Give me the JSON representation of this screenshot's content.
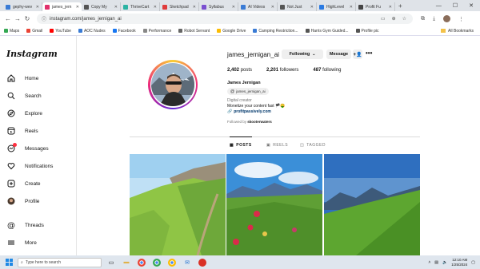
{
  "browser": {
    "tabs": [
      {
        "label": "gephy-wev",
        "color": "#3a7bd5"
      },
      {
        "label": "james_jern",
        "color": "#e1306c",
        "active": true
      },
      {
        "label": "Copy My",
        "color": "#555"
      },
      {
        "label": "ThriveCart",
        "color": "#2bb3a3"
      },
      {
        "label": "Sketchpad",
        "color": "#e03b3b"
      },
      {
        "label": "Syllabus",
        "color": "#7a4fd0"
      },
      {
        "label": "AI Videos",
        "color": "#3a7bd5"
      },
      {
        "label": "Not Just",
        "color": "#555"
      },
      {
        "label": "HighLevel",
        "color": "#2a7ae2"
      },
      {
        "label": "Profit Fu",
        "color": "#444"
      }
    ],
    "url": "instagram.com/james_jernigan_ai",
    "bookmarks": [
      {
        "label": "Maps",
        "color": "#34a853"
      },
      {
        "label": "Gmail",
        "color": "#ea4335"
      },
      {
        "label": "YouTube",
        "color": "#ff0000"
      },
      {
        "label": "AOC Nudes",
        "color": "#3a7bd5"
      },
      {
        "label": "Facebook",
        "color": "#1877f2"
      },
      {
        "label": "Performance",
        "color": "#888"
      },
      {
        "label": "Robot Servant",
        "color": "#666"
      },
      {
        "label": "Google Drive",
        "color": "#fbbc04"
      },
      {
        "label": "Camping Restriction...",
        "color": "#3a7bd5"
      },
      {
        "label": "Harris Gym Guided...",
        "color": "#555"
      },
      {
        "label": "Profile pic",
        "color": "#555"
      }
    ],
    "all_bookmarks": "All Bookmarks"
  },
  "sidebar": {
    "logo": "Instagram",
    "items": [
      {
        "label": "Home",
        "icon": "home-icon"
      },
      {
        "label": "Search",
        "icon": "search-icon"
      },
      {
        "label": "Explore",
        "icon": "compass-icon"
      },
      {
        "label": "Reels",
        "icon": "reels-icon"
      },
      {
        "label": "Messages",
        "icon": "messenger-icon",
        "badge": "1"
      },
      {
        "label": "Notifications",
        "icon": "heart-icon"
      },
      {
        "label": "Create",
        "icon": "plus-square-icon"
      },
      {
        "label": "Profile",
        "icon": "profile-icon"
      },
      {
        "label": "Threads",
        "icon": "threads-icon"
      },
      {
        "label": "More",
        "icon": "menu-icon"
      }
    ]
  },
  "profile": {
    "username": "james_jernigan_ai",
    "following_btn": "Following",
    "message_btn": "Message",
    "stats": {
      "posts": "2,402",
      "posts_label": "posts",
      "followers": "2,201",
      "followers_label": "followers",
      "following": "487",
      "following_label": "following"
    },
    "full_name": "James Jernigan",
    "threads_handle": "james_jernigan_ai",
    "category": "Digital creator",
    "bio": "Monetize your content fast 🏴🤑",
    "link": "profitpassively.com",
    "followed_by": "Followed by ",
    "followed_by_user": "skooterwaters"
  },
  "post_tabs": [
    "POSTS",
    "REELS",
    "TAGGED"
  ],
  "taskbar": {
    "search_placeholder": "Type here to search",
    "time": "12:10 AM",
    "date": "1/25/2024"
  }
}
